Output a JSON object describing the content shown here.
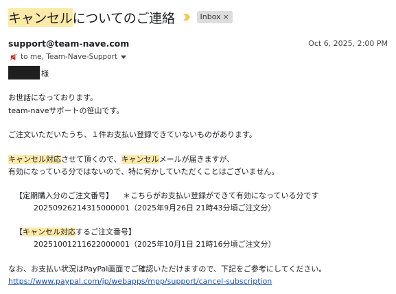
{
  "subject": {
    "hl": "キャンセル",
    "rest": "についてのご連絡"
  },
  "label": {
    "text": "Inbox",
    "close": "×"
  },
  "sender": {
    "email": "support@team-nave.com",
    "date": "Oct 6, 2025, 2:00 PM"
  },
  "recipients": {
    "text": "to me, Team-Nave-Support"
  },
  "greeting": {
    "honorific": "様"
  },
  "body": {
    "p1": "お世話になっております。",
    "p2": "team-naveサポートの笹山です。",
    "p3": "ご注文いただいたうち、１件お支払い登録できていないものがあります。",
    "p4": {
      "hl1": "キャンセル対応",
      "t1": "させて頂くので、",
      "hl2": "キャンセル",
      "t2": "メールが届きますが、"
    },
    "p5": "有効になっている分ではないので、特に何かしていただくことはございません。",
    "sec1": {
      "heading": "【定期購入分のご注文番号】",
      "note": "＊こちらがお支払い登録ができて有効になっている分です",
      "order": "20250926214315000001（2025年9月26日 21時43分頃ご注文分）"
    },
    "sec2": {
      "open": "【",
      "hl": "キャンセル対応",
      "rest": "するご注文番号】",
      "order": "20251001211622000001（2025年10月1日 21時16分頃ご注文分）"
    },
    "p6": "なお、お支払い状況はPayPal画面でご確認いただけますので、下記をご参考にしてください。",
    "link": "https://www.paypal.com/jp/webapps/mpp/support/cancel-subscription"
  }
}
